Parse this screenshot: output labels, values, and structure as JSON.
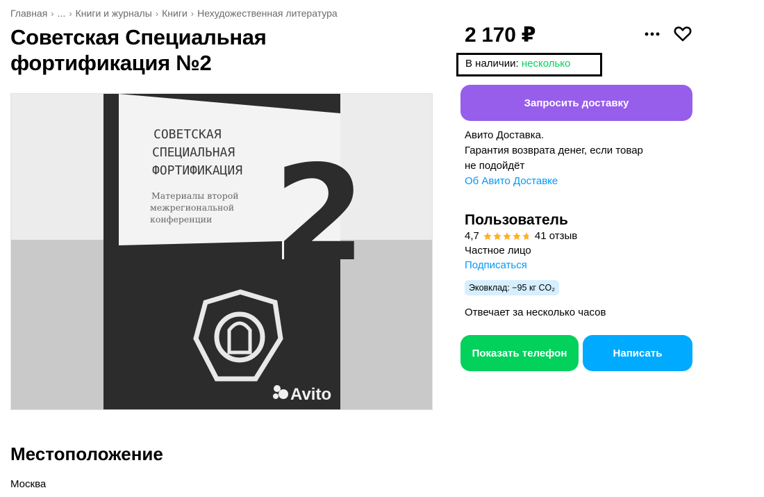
{
  "breadcrumbs": [
    "Главная",
    "...",
    "Книги и журналы",
    "Книги",
    "Нехудожественная литература"
  ],
  "title": "Советская Специальная фортификация №2",
  "image": {
    "book_title_lines": [
      "СОВЕТСКАЯ",
      "СПЕЦИАЛЬНАЯ",
      "ФОРТИФИКАЦИЯ"
    ],
    "book_subtitle_lines": [
      "Материалы второй",
      "межрегиональной",
      "конференции"
    ],
    "book_number": "2",
    "watermark": "Avito"
  },
  "price": "2 170 ₽",
  "stock": {
    "label": "В наличии:",
    "value": "несколько"
  },
  "delivery_button": "Запросить доставку",
  "delivery": {
    "line1": "Авито Доставка.",
    "line2": "Гарантия возврата денег, если товар",
    "line3": "не подойдёт",
    "link": "Об Авито Доставке"
  },
  "seller": {
    "name": "Пользователь",
    "rating": "4,7",
    "rating_value": 4.7,
    "reviews": "41 отзыв",
    "type": "Частное лицо",
    "subscribe": "Подписаться",
    "eco": "Эковклад: −95 кг CO₂",
    "reply_time": "Отвечает за несколько часов"
  },
  "actions": {
    "phone": "Показать телефон",
    "write": "Написать"
  },
  "location": {
    "section_title": "Местоположение",
    "city": "Москва"
  },
  "colors": {
    "stock": "#02d15c",
    "delivery_button": "#965eeb",
    "phone_button": "#02d15c",
    "write_button": "#00aaff",
    "link": "#0099f7",
    "star": "#ffb021",
    "eco_badge": "#d6efff"
  },
  "icons": [
    "more-icon",
    "heart-icon",
    "star-icon"
  ]
}
